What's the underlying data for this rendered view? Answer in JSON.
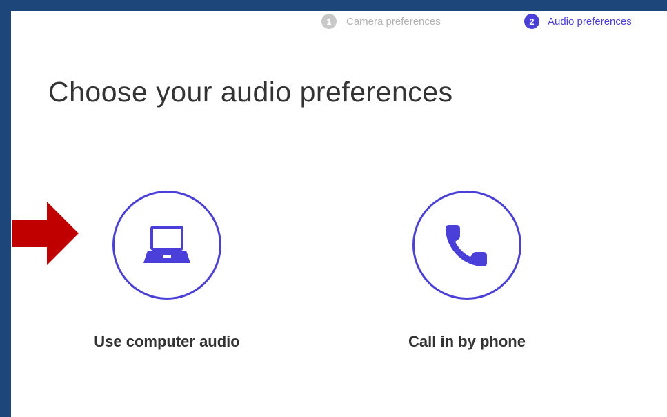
{
  "steps": [
    {
      "number": "1",
      "label": "Camera preferences"
    },
    {
      "number": "2",
      "label": "Audio preferences"
    }
  ],
  "title": "Choose your audio preferences",
  "options": [
    {
      "label": "Use computer audio",
      "icon": "laptop-icon"
    },
    {
      "label": "Call in by phone",
      "icon": "phone-icon"
    }
  ],
  "colors": {
    "accent": "#4a40d9",
    "inactive_step": "#c8c8c8",
    "background_frame": "#1d477a",
    "arrow": "#c00000",
    "text": "#333333"
  }
}
